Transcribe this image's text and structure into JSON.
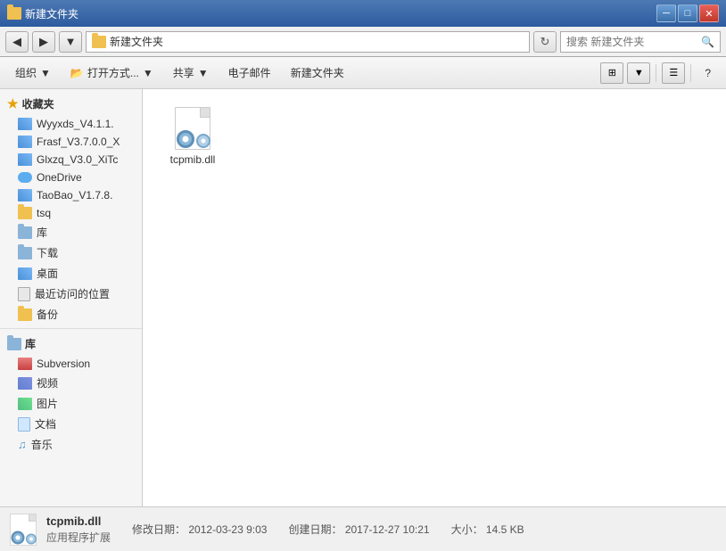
{
  "window": {
    "title": "新建文件夹"
  },
  "titlebar": {
    "title": "新建文件夹",
    "minimize": "─",
    "maximize": "□",
    "close": "✕"
  },
  "addressbar": {
    "path": "新建文件夹",
    "folder_icon": "folder",
    "search_placeholder": "搜索 新建文件夹",
    "back_arrow": "◀",
    "forward_arrow": "▶",
    "refresh": "↻",
    "dropdown_arrow": "▼"
  },
  "toolbar": {
    "organize": "组织",
    "open_with": "打开方式...",
    "share": "共享",
    "email": "电子邮件",
    "new_folder": "新建文件夹",
    "organize_arrow": "▼",
    "open_arrow": "▼",
    "share_arrow": "▼",
    "help": "?"
  },
  "sidebar": {
    "favorites_header": "收藏夹",
    "favorites_items": [
      {
        "label": "Wyyxds_V4.1.1.",
        "icon": "stack"
      },
      {
        "label": "Frasf_V3.7.0.0_X",
        "icon": "stack"
      },
      {
        "label": "Glxzq_V3.0_XiTc",
        "icon": "stack"
      },
      {
        "label": "OneDrive",
        "icon": "cloud"
      },
      {
        "label": "TaoBao_V1.7.8.",
        "icon": "stack"
      },
      {
        "label": "tsq",
        "icon": "folder"
      },
      {
        "label": "库",
        "icon": "folder-blue"
      },
      {
        "label": "下载",
        "icon": "folder-blue"
      },
      {
        "label": "桌面",
        "icon": "stack"
      },
      {
        "label": "最近访问的位置",
        "icon": "generic"
      },
      {
        "label": "备份",
        "icon": "folder"
      }
    ],
    "library_header": "库",
    "library_items": [
      {
        "label": "Subversion",
        "icon": "subversion"
      },
      {
        "label": "视频",
        "icon": "video"
      },
      {
        "label": "图片",
        "icon": "image"
      },
      {
        "label": "文档",
        "icon": "doc"
      },
      {
        "label": "音乐",
        "icon": "music"
      }
    ]
  },
  "files": [
    {
      "name": "tcpmib.dll",
      "type": "dll"
    }
  ],
  "statusbar": {
    "filename": "tcpmib.dll",
    "type": "应用程序扩展",
    "modified_label": "修改日期：",
    "modified_date": "2012-03-23 9:03",
    "created_label": "创建日期：",
    "created_date": "2017-12-27 10:21",
    "size_label": "大小：",
    "size": "14.5 KB"
  }
}
